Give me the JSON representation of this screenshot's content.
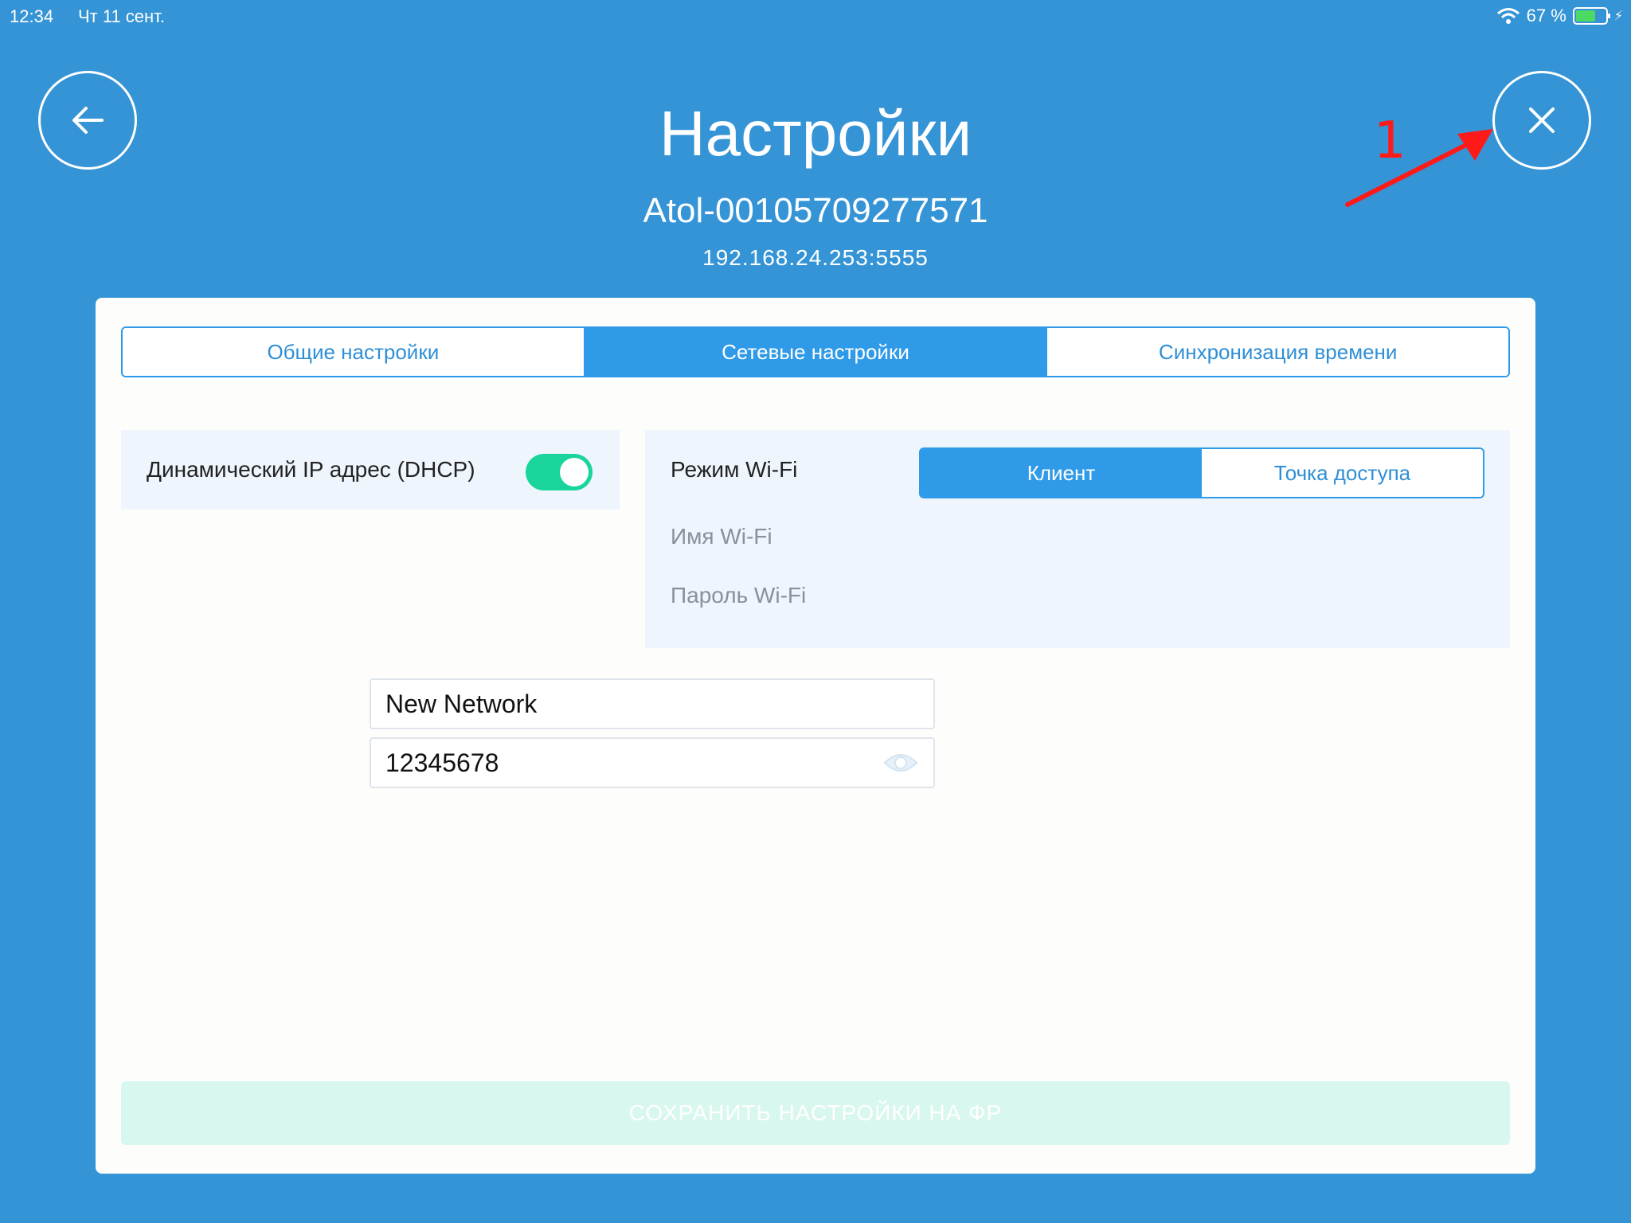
{
  "status_bar": {
    "time": "12:34",
    "date": "Чт 11 сент.",
    "battery_percent": "67 %",
    "battery_level": 0.67
  },
  "header": {
    "title": "Настройки",
    "device_name": "Atol-00105709277571",
    "address": "192.168.24.253:5555",
    "back_icon": "arrow-left-icon",
    "close_icon": "close-icon"
  },
  "annotation": {
    "number": "1",
    "color": "#ff1a1a"
  },
  "tabs": [
    {
      "label": "Общие настройки",
      "active": false
    },
    {
      "label": "Сетевые настройки",
      "active": true
    },
    {
      "label": "Синхронизация времени",
      "active": false
    }
  ],
  "dhcp": {
    "label": "Динамический IP адрес (DHCP)",
    "enabled": true
  },
  "wifi": {
    "mode_label": "Режим Wi-Fi",
    "modes": [
      "Клиент",
      "Точка доступа"
    ],
    "selected_mode": "Клиент",
    "name_label": "Имя Wi-Fi",
    "name_value": "New Network",
    "password_label": "Пароль Wi-Fi",
    "password_value": "12345678",
    "password_icon": "eye-icon"
  },
  "save_button": {
    "label": "СОХРАНИТЬ НАСТРОЙКИ НА ФР",
    "enabled": false
  },
  "colors": {
    "background": "#3594d6",
    "accent": "#2f9ae8",
    "toggle_on": "#19d59b"
  }
}
